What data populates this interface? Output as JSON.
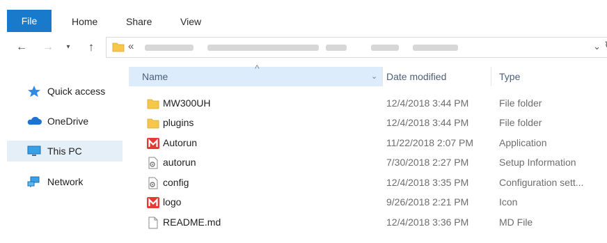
{
  "ribbon": {
    "tabs": [
      "File",
      "Home",
      "Share",
      "View"
    ]
  },
  "address_bar": {
    "overflow_chevron": "«",
    "dropdown_glyph": "⌄",
    "refresh_glyph": "↻"
  },
  "nav_buttons": {
    "back": "←",
    "forward": "→",
    "recent": "▾",
    "up": "↑"
  },
  "nav_pane": {
    "items": [
      {
        "label": "Quick access",
        "icon": "star-icon"
      },
      {
        "label": "OneDrive",
        "icon": "cloud-icon"
      },
      {
        "label": "This PC",
        "icon": "monitor-icon",
        "selected": true
      },
      {
        "label": "Network",
        "icon": "network-icon"
      }
    ]
  },
  "columns": {
    "name": "Name",
    "date": "Date modified",
    "type": "Type"
  },
  "files": [
    {
      "name": "MW300UH",
      "date": "12/4/2018 3:44 PM",
      "type": "File folder",
      "icon": "folder-icon"
    },
    {
      "name": "plugins",
      "date": "12/4/2018 3:44 PM",
      "type": "File folder",
      "icon": "folder-icon"
    },
    {
      "name": "Autorun",
      "date": "11/22/2018 2:07 PM",
      "type": "Application",
      "icon": "mercusys-m-icon"
    },
    {
      "name": "autorun",
      "date": "7/30/2018 2:27 PM",
      "type": "Setup Information",
      "icon": "settings-file-icon"
    },
    {
      "name": "config",
      "date": "12/4/2018 3:35 PM",
      "type": "Configuration sett...",
      "icon": "settings-file-icon"
    },
    {
      "name": "logo",
      "date": "9/26/2018 2:21 PM",
      "type": "Icon",
      "icon": "mercusys-m-icon"
    },
    {
      "name": "README.md",
      "date": "12/4/2018 3:36 PM",
      "type": "MD File",
      "icon": "document-icon"
    }
  ],
  "colors": {
    "file_tab": "#1979ca",
    "header_highlight": "#dcecfb",
    "selected_nav": "#e5eff8",
    "folder": "#f6c74a",
    "brand_m": "#e53935"
  }
}
